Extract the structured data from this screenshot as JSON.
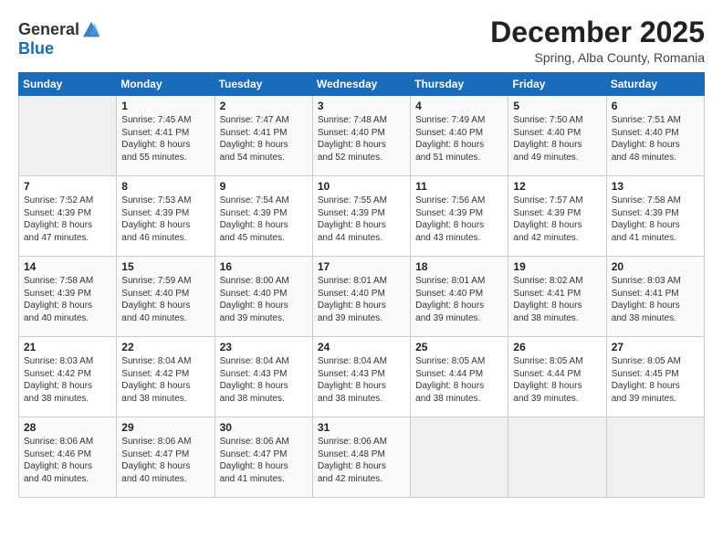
{
  "logo": {
    "general": "General",
    "blue": "Blue"
  },
  "header": {
    "month": "December 2025",
    "location": "Spring, Alba County, Romania"
  },
  "days": [
    "Sunday",
    "Monday",
    "Tuesday",
    "Wednesday",
    "Thursday",
    "Friday",
    "Saturday"
  ],
  "weeks": [
    [
      {
        "day": "",
        "content": ""
      },
      {
        "day": "1",
        "content": "Sunrise: 7:45 AM\nSunset: 4:41 PM\nDaylight: 8 hours\nand 55 minutes."
      },
      {
        "day": "2",
        "content": "Sunrise: 7:47 AM\nSunset: 4:41 PM\nDaylight: 8 hours\nand 54 minutes."
      },
      {
        "day": "3",
        "content": "Sunrise: 7:48 AM\nSunset: 4:40 PM\nDaylight: 8 hours\nand 52 minutes."
      },
      {
        "day": "4",
        "content": "Sunrise: 7:49 AM\nSunset: 4:40 PM\nDaylight: 8 hours\nand 51 minutes."
      },
      {
        "day": "5",
        "content": "Sunrise: 7:50 AM\nSunset: 4:40 PM\nDaylight: 8 hours\nand 49 minutes."
      },
      {
        "day": "6",
        "content": "Sunrise: 7:51 AM\nSunset: 4:40 PM\nDaylight: 8 hours\nand 48 minutes."
      }
    ],
    [
      {
        "day": "7",
        "content": "Sunrise: 7:52 AM\nSunset: 4:39 PM\nDaylight: 8 hours\nand 47 minutes."
      },
      {
        "day": "8",
        "content": "Sunrise: 7:53 AM\nSunset: 4:39 PM\nDaylight: 8 hours\nand 46 minutes."
      },
      {
        "day": "9",
        "content": "Sunrise: 7:54 AM\nSunset: 4:39 PM\nDaylight: 8 hours\nand 45 minutes."
      },
      {
        "day": "10",
        "content": "Sunrise: 7:55 AM\nSunset: 4:39 PM\nDaylight: 8 hours\nand 44 minutes."
      },
      {
        "day": "11",
        "content": "Sunrise: 7:56 AM\nSunset: 4:39 PM\nDaylight: 8 hours\nand 43 minutes."
      },
      {
        "day": "12",
        "content": "Sunrise: 7:57 AM\nSunset: 4:39 PM\nDaylight: 8 hours\nand 42 minutes."
      },
      {
        "day": "13",
        "content": "Sunrise: 7:58 AM\nSunset: 4:39 PM\nDaylight: 8 hours\nand 41 minutes."
      }
    ],
    [
      {
        "day": "14",
        "content": "Sunrise: 7:58 AM\nSunset: 4:39 PM\nDaylight: 8 hours\nand 40 minutes."
      },
      {
        "day": "15",
        "content": "Sunrise: 7:59 AM\nSunset: 4:40 PM\nDaylight: 8 hours\nand 40 minutes."
      },
      {
        "day": "16",
        "content": "Sunrise: 8:00 AM\nSunset: 4:40 PM\nDaylight: 8 hours\nand 39 minutes."
      },
      {
        "day": "17",
        "content": "Sunrise: 8:01 AM\nSunset: 4:40 PM\nDaylight: 8 hours\nand 39 minutes."
      },
      {
        "day": "18",
        "content": "Sunrise: 8:01 AM\nSunset: 4:40 PM\nDaylight: 8 hours\nand 39 minutes."
      },
      {
        "day": "19",
        "content": "Sunrise: 8:02 AM\nSunset: 4:41 PM\nDaylight: 8 hours\nand 38 minutes."
      },
      {
        "day": "20",
        "content": "Sunrise: 8:03 AM\nSunset: 4:41 PM\nDaylight: 8 hours\nand 38 minutes."
      }
    ],
    [
      {
        "day": "21",
        "content": "Sunrise: 8:03 AM\nSunset: 4:42 PM\nDaylight: 8 hours\nand 38 minutes."
      },
      {
        "day": "22",
        "content": "Sunrise: 8:04 AM\nSunset: 4:42 PM\nDaylight: 8 hours\nand 38 minutes."
      },
      {
        "day": "23",
        "content": "Sunrise: 8:04 AM\nSunset: 4:43 PM\nDaylight: 8 hours\nand 38 minutes."
      },
      {
        "day": "24",
        "content": "Sunrise: 8:04 AM\nSunset: 4:43 PM\nDaylight: 8 hours\nand 38 minutes."
      },
      {
        "day": "25",
        "content": "Sunrise: 8:05 AM\nSunset: 4:44 PM\nDaylight: 8 hours\nand 38 minutes."
      },
      {
        "day": "26",
        "content": "Sunrise: 8:05 AM\nSunset: 4:44 PM\nDaylight: 8 hours\nand 39 minutes."
      },
      {
        "day": "27",
        "content": "Sunrise: 8:05 AM\nSunset: 4:45 PM\nDaylight: 8 hours\nand 39 minutes."
      }
    ],
    [
      {
        "day": "28",
        "content": "Sunrise: 8:06 AM\nSunset: 4:46 PM\nDaylight: 8 hours\nand 40 minutes."
      },
      {
        "day": "29",
        "content": "Sunrise: 8:06 AM\nSunset: 4:47 PM\nDaylight: 8 hours\nand 40 minutes."
      },
      {
        "day": "30",
        "content": "Sunrise: 8:06 AM\nSunset: 4:47 PM\nDaylight: 8 hours\nand 41 minutes."
      },
      {
        "day": "31",
        "content": "Sunrise: 8:06 AM\nSunset: 4:48 PM\nDaylight: 8 hours\nand 42 minutes."
      },
      {
        "day": "",
        "content": ""
      },
      {
        "day": "",
        "content": ""
      },
      {
        "day": "",
        "content": ""
      }
    ]
  ]
}
